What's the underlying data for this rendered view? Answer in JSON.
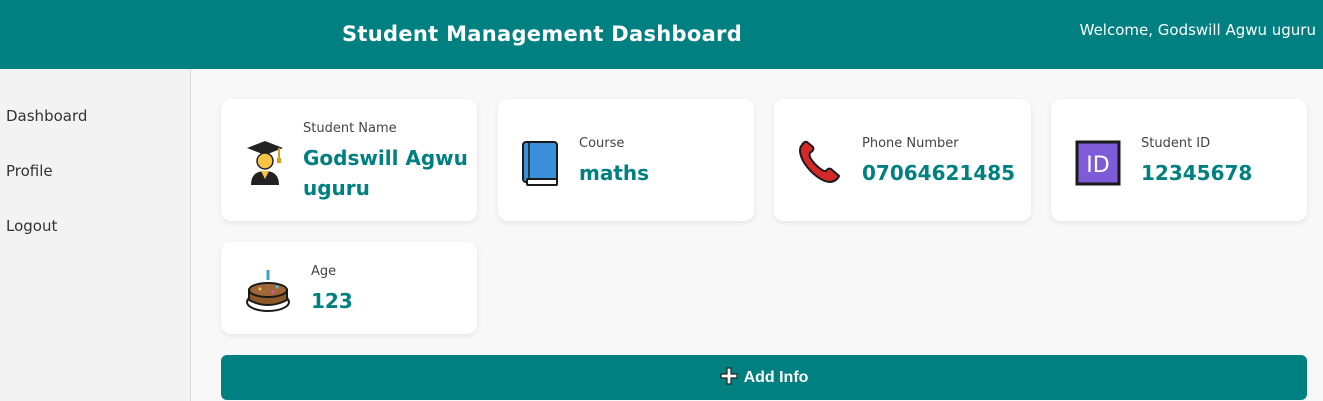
{
  "header": {
    "title": "Student Management Dashboard",
    "welcome": "Welcome, Godswill Agwu uguru"
  },
  "sidebar": {
    "items": [
      {
        "label": "Dashboard"
      },
      {
        "label": "Profile"
      },
      {
        "label": "Logout"
      }
    ]
  },
  "cards": {
    "name": {
      "label": "Student Name",
      "value": "Godswill Agwu uguru",
      "icon": "graduate-icon"
    },
    "course": {
      "label": "Course",
      "value": "maths",
      "icon": "book-icon"
    },
    "phone": {
      "label": "Phone Number",
      "value": "07064621485",
      "icon": "telephone-icon"
    },
    "student_id": {
      "label": "Student ID",
      "value": "12345678",
      "icon": "id-icon"
    },
    "age": {
      "label": "Age",
      "value": "123",
      "icon": "cake-icon"
    }
  },
  "actions": {
    "add_info": "Add Info"
  },
  "colors": {
    "accent": "#008080",
    "background": "#f8f8f8",
    "card": "#ffffff"
  }
}
